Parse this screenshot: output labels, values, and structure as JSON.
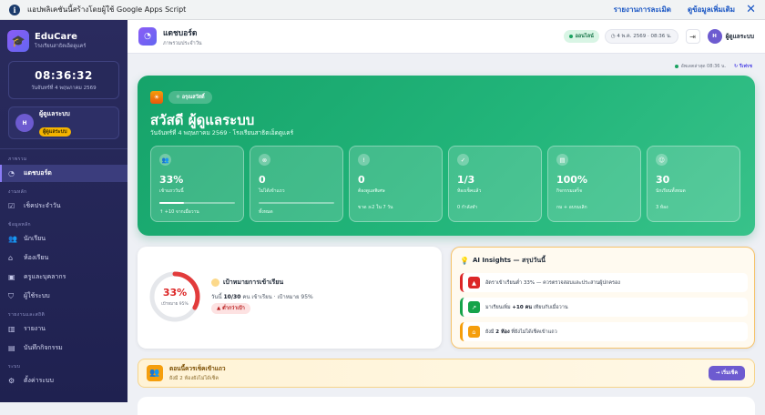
{
  "banner": {
    "text": "แอปพลิเคชันนี้สร้างโดยผู้ใช้ Google Apps Script",
    "report_link": "รายงานการละเมิด",
    "more_link": "ดูข้อมูลเพิ่มเติม"
  },
  "sidebar": {
    "brand_name": "EduCare",
    "brand_sub": "โรงเรียนสาธิตเอ็ดดูแคร์",
    "clock_time": "08:36:32",
    "clock_date": "วันจันทร์ที่ 4 พฤษภาคม 2569",
    "user_initial": "H",
    "user_name": "ผู้ดูแลระบบ",
    "user_role": "ผู้ดูแลระบบ",
    "groups": [
      {
        "label": "ภาพรวม",
        "items": [
          {
            "label": "แดชบอร์ด",
            "icon": "dashboard-icon",
            "active": true
          }
        ]
      },
      {
        "label": "งานหลัก",
        "items": [
          {
            "label": "เช็คประจำวัน",
            "icon": "checklist-icon"
          }
        ]
      },
      {
        "label": "ข้อมูลหลัก",
        "items": [
          {
            "label": "นักเรียน",
            "icon": "students-icon"
          },
          {
            "label": "ห้องเรียน",
            "icon": "classroom-icon"
          },
          {
            "label": "ครูและบุคลากร",
            "icon": "staff-icon"
          },
          {
            "label": "ผู้ใช้ระบบ",
            "icon": "shield-icon"
          }
        ]
      },
      {
        "label": "รายงานและสถิติ",
        "items": [
          {
            "label": "รายงาน",
            "icon": "report-icon"
          },
          {
            "label": "บันทึกกิจกรรม",
            "icon": "log-icon"
          }
        ]
      },
      {
        "label": "ระบบ",
        "items": [
          {
            "label": "ตั้งค่าระบบ",
            "icon": "settings-icon"
          }
        ]
      }
    ]
  },
  "topbar": {
    "title": "แดชบอร์ด",
    "subtitle": "ภาพรวมประจำวัน",
    "status": "ออนไลน์",
    "date": "4 พ.ค. 2569 · 08:36 น.",
    "user_initial": "H",
    "user_name": "ผู้ดูแลระบบ"
  },
  "updated": {
    "text": "อัพเดตล่าสุด 08:36 น.",
    "refresh": "รีเฟรช"
  },
  "hero": {
    "tag": "อรุณสวัสดิ์",
    "greeting": "สวัสดี ผู้ดูแลระบบ",
    "subline": "วันจันทร์ที่ 4 พฤษภาคม 2569 · โรงเรียนสาธิตเอ็ดดูแคร์",
    "kpis": [
      {
        "icon": "people-icon",
        "value": "33%",
        "label": "เข้าแถววันนี้",
        "foot": "↑ +10 จากเมื่อวาน",
        "progress": 0.33
      },
      {
        "icon": "close-circle-icon",
        "value": "0",
        "label": "ไม่ได้เข้าแถว",
        "foot": "ทั้งหมด",
        "progress": 0
      },
      {
        "icon": "alert-icon",
        "value": "0",
        "label": "ต้องดูแลพิเศษ",
        "foot": "ขาด ≥2 ใน 7 วัน",
        "progress": null
      },
      {
        "icon": "check-icon",
        "value": "1/3",
        "label": "ห้องเช็คแล้ว",
        "foot": "0 กำลังทำ",
        "progress": null
      },
      {
        "icon": "clipboard-icon",
        "value": "100%",
        "label": "กิจกรรมเสร็จ",
        "foot": "กม + อบรมเลิก",
        "progress": null
      },
      {
        "icon": "smile-icon",
        "value": "30",
        "label": "นักเรียนทั้งหมด",
        "foot": "3 ห้อง",
        "progress": null
      }
    ]
  },
  "attendance": {
    "ring_value": "33%",
    "ring_label": "เป้าหมาย 95%",
    "ring_fraction": 0.33,
    "title": "เป้าหมายการเข้าเรียน",
    "detail_prefix": "วันนี้",
    "detail_count": "10/30",
    "detail_suffix": "คน เข้าเรียน · เป้าหมาย 95%",
    "warning": "ต่ำกว่าเป้า"
  },
  "ai": {
    "title": "AI Insights — สรุปวันนี้",
    "items": [
      {
        "icon": "warning-icon",
        "color": "#dc2626",
        "text": "อัตราเข้าเรียนต่ำ 33% — ควรตรวจสอบและประสานผู้ปกครอง"
      },
      {
        "icon": "trend-up-icon",
        "color": "#16a34a",
        "text_pre": "มาเรียนเพิ่ม",
        "text_bold": "+10 คน",
        "text_post": "เทียบกับเมื่อวาน"
      },
      {
        "icon": "home-icon",
        "color": "#f59e0b",
        "text_pre": "ยังมี",
        "text_bold": "2 ห้อง",
        "text_post": "ที่ยังไม่ได้เช็คเข้าแถว"
      }
    ]
  },
  "callout": {
    "title": "ตอนนี้ควรเช็คเข้าแถว",
    "sub": "ยังมี 2 ห้องยังไม่ได้เช็ค",
    "button": "→ เริ่มเช็ค"
  }
}
